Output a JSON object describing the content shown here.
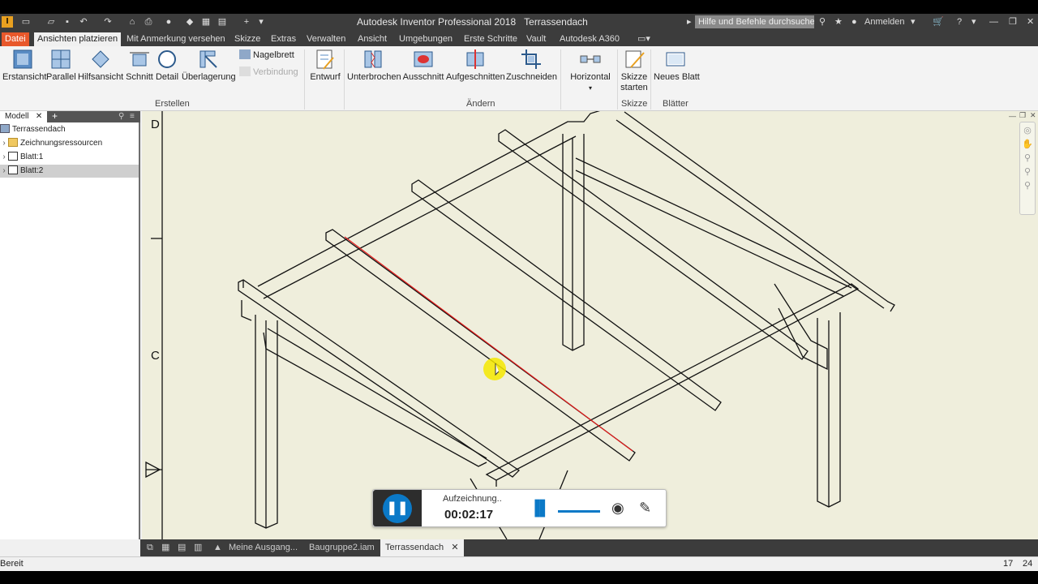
{
  "app": {
    "title": "Autodesk Inventor Professional 2018",
    "document": "Terrassendach",
    "search_placeholder": "Hilfe und Befehle durchsuchen",
    "signin": "Anmelden"
  },
  "tabs": [
    {
      "label": "Datei"
    },
    {
      "label": "Ansichten platzieren"
    },
    {
      "label": "Mit Anmerkung versehen"
    },
    {
      "label": "Skizze"
    },
    {
      "label": "Extras"
    },
    {
      "label": "Verwalten"
    },
    {
      "label": "Ansicht"
    },
    {
      "label": "Umgebungen"
    },
    {
      "label": "Erste Schritte"
    },
    {
      "label": "Vault"
    },
    {
      "label": "Autodesk A360"
    }
  ],
  "ribbon": {
    "erstellen": {
      "group_label": "Erstellen",
      "buttons": [
        "Erstansicht",
        "Parallel",
        "Hilfsansicht",
        "Schnitt",
        "Detail",
        "Überlagerung"
      ],
      "small": [
        "Nagelbrett",
        "Verbindung"
      ]
    },
    "entwurf": "Entwurf",
    "aendern": {
      "group_label": "Ändern",
      "buttons": [
        "Unterbrochen",
        "Ausschnitt",
        "Aufgeschnitten",
        "Zuschneiden",
        "Horizontal"
      ]
    },
    "skizze": {
      "group_label": "Skizze",
      "button_line1": "Skizze",
      "button_line2": "starten"
    },
    "blaetter": {
      "group_label": "Blätter",
      "button": "Neues Blatt"
    }
  },
  "browser": {
    "tab_label": "Modell",
    "nodes": [
      {
        "label": "Terrassendach"
      },
      {
        "label": "Zeichnungsressourcen"
      },
      {
        "label": "Blatt:1"
      },
      {
        "label": "Blatt:2"
      }
    ]
  },
  "drawing": {
    "zone_labels": [
      "D",
      "C"
    ],
    "accent_highlight": "#e41b1b"
  },
  "recorder": {
    "status": "Aufzeichnung..",
    "time": "00:02:17",
    "accent": "#0b79c7"
  },
  "doc_tabs": [
    "Meine Ausgang...",
    "Baugruppe2.iam",
    "Terrassendach"
  ],
  "status": {
    "text": "Bereit",
    "num1": "17",
    "num2": "24"
  }
}
